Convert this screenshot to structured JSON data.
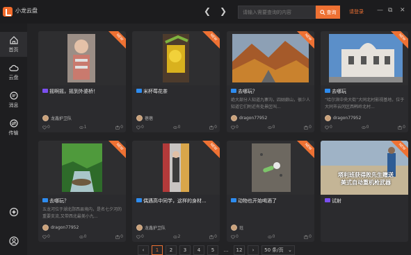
{
  "app": {
    "title": "小龙云盘"
  },
  "search": {
    "placeholder": "请输入需要查询的内容",
    "button_label": "查询"
  },
  "header": {
    "login_label": "请登录"
  },
  "sidebar": {
    "items": [
      {
        "label": "首页",
        "icon": "home-icon"
      },
      {
        "label": "云盘",
        "icon": "cloud-icon"
      },
      {
        "label": "消息",
        "icon": "message-icon"
      },
      {
        "label": "传输",
        "icon": "transfer-icon"
      }
    ]
  },
  "badge_text": "NEW",
  "cards": [
    {
      "title": "摇啊摇，摇到外婆桥！",
      "tag": "purple",
      "desc": "",
      "author": "龙鑫护卫队",
      "stats": [
        "0",
        "1",
        "0"
      ]
    },
    {
      "title": "米杯莓花茶",
      "tag": "blue",
      "desc": "",
      "author": "蓓蓓",
      "stats": [
        "0",
        "0",
        "0"
      ]
    },
    {
      "title": "去哪玩？",
      "tag": "blue",
      "desc": "绝大部分人知道九寨沟，四姑娘山，很少人知道它们附近有处景区叫...",
      "author": "dragon77952",
      "stats": [
        "0",
        "0",
        "0"
      ]
    },
    {
      "title": "去哪玩",
      "tag": "blue",
      "desc": "“哈尔滨中央大街”大同北村影视基地，位于大同市云冈区西韩岭北村...",
      "author": "dragon77952",
      "stats": [
        "0",
        "0",
        "0"
      ]
    },
    {
      "title": "去哪玩？",
      "tag": "blue",
      "desc": "五龙河位于湖北郧西县境内，是名七夕河的重要支流,又带西北最美小九...",
      "author": "dragon77952",
      "stats": [
        "0",
        "0",
        "0"
      ]
    },
    {
      "title": "偶遇高中同学，这样的身材...",
      "tag": "blue",
      "desc": "",
      "author": "龙鑫护卫队",
      "stats": [
        "0",
        "2",
        "0"
      ]
    },
    {
      "title": "动物也开始喝酒了",
      "tag": "blue",
      "desc": "",
      "author": "珏",
      "stats": [
        "0",
        "0",
        "0"
      ]
    },
    {
      "title": "试射",
      "tag": "purple",
      "desc": "",
      "author": "",
      "stats": [
        "",
        "",
        ""
      ]
    }
  ],
  "video_caption": {
    "line1": "塔利班获得败先生赠送",
    "line2": "美式自动重机枪武器"
  },
  "pagination": {
    "prev": "‹",
    "pages": [
      "1",
      "2",
      "3",
      "4",
      "5"
    ],
    "ellipsis": "...",
    "last": "12",
    "next": "›",
    "per_page": "50 条/页",
    "current": "1"
  },
  "colors": {
    "accent": "#ee7133",
    "bg": "#232325",
    "card": "#2b2b2e"
  }
}
